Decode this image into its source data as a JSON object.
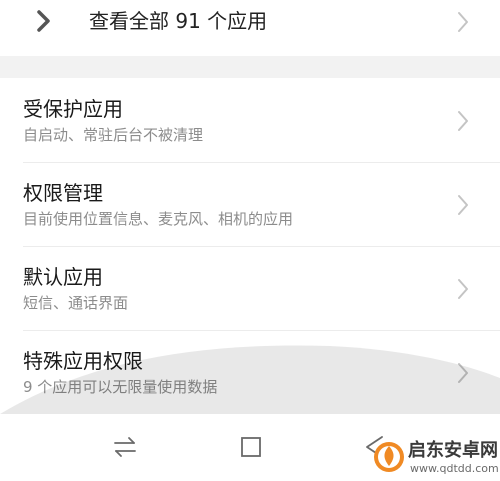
{
  "top_item": {
    "label": "查看全部 91 个应用"
  },
  "items": [
    {
      "title": "受保护应用",
      "subtitle": "自启动、常驻后台不被清理"
    },
    {
      "title": "权限管理",
      "subtitle": "目前使用位置信息、麦克风、相机的应用"
    },
    {
      "title": "默认应用",
      "subtitle": "短信、通话界面"
    },
    {
      "title": "特殊应用权限",
      "subtitle": "9 个应用可以无限量使用数据"
    }
  ],
  "watermark": {
    "text": "启东安卓网",
    "url": "www.qdtdd.com"
  },
  "colors": {
    "background": "#ffffff",
    "section_gap": "#f2f2f2",
    "title_text": "#1a1a1a",
    "subtitle_text": "#8c8c8c",
    "chevron": "#c4c4c4",
    "logo_orange": "#f08a24"
  },
  "icons": {
    "top_left": "chevron-right-bold-icon",
    "row_arrow": "chevron-right-icon",
    "nav": [
      "switch-arrows-icon",
      "square-home-icon",
      "back-triangle-icon"
    ],
    "watermark_logo": "flame-logo-icon"
  }
}
